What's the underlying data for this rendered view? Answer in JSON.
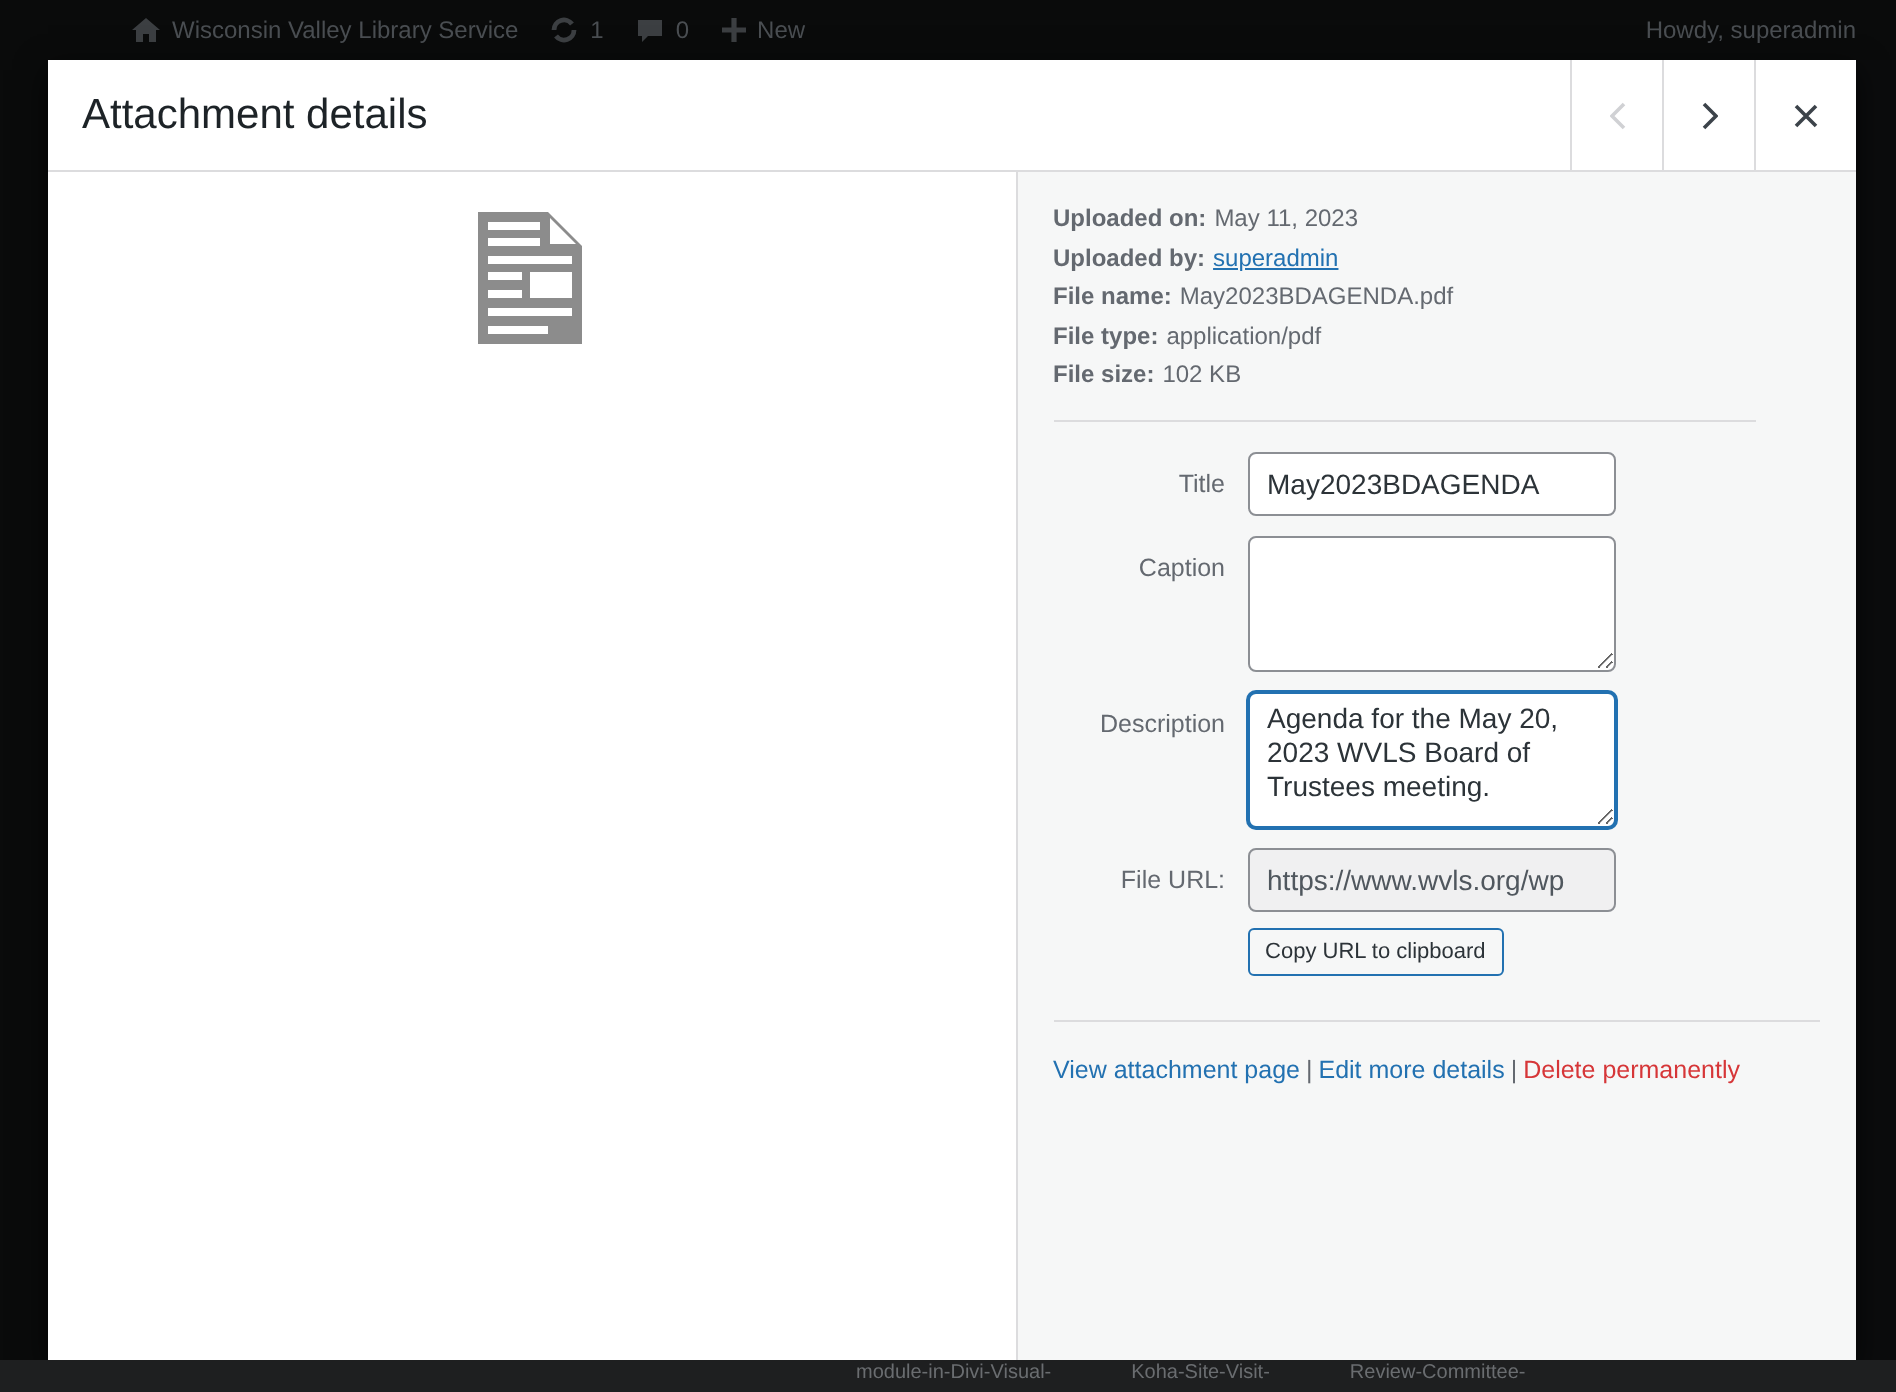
{
  "admin_bar": {
    "site": "Wisconsin Valley Library Service",
    "updates": "1",
    "comments": "0",
    "new": "New",
    "greeting": "Howdy, superadmin"
  },
  "modal": {
    "title": "Attachment details",
    "nav": [
      {
        "kind": "prev",
        "disabled": true
      },
      {
        "kind": "next",
        "disabled": false
      },
      {
        "kind": "close",
        "disabled": false
      }
    ],
    "meta": [
      {
        "kind": "text",
        "label": "Uploaded on:",
        "value": "May 11, 2023"
      },
      {
        "kind": "link",
        "label": "Uploaded by:",
        "value": "superadmin"
      },
      {
        "kind": "text",
        "label": "File name:",
        "value": "May2023BDAGENDA.pdf"
      },
      {
        "kind": "text",
        "label": "File type:",
        "value": "application/pdf"
      },
      {
        "kind": "text",
        "label": "File size:",
        "value": "102 KB"
      }
    ],
    "fields": [
      {
        "kind": "input",
        "label": "Title",
        "value": "May2023BDAGENDA",
        "focused": false,
        "readonly": false
      },
      {
        "kind": "textarea",
        "label": "Caption",
        "focused": false,
        "readonly": false
      },
      {
        "kind": "textarea",
        "label": "Description",
        "value": "Agenda for the May 20, 2023 WVLS Board of Trustees meeting.",
        "focused": true,
        "readonly": false
      },
      {
        "kind": "input",
        "label": "File URL:",
        "value": "https://www.wvls.org/wp",
        "focused": false,
        "readonly": true
      }
    ],
    "copy_button": "Copy URL to clipboard",
    "actions": [
      {
        "kind": "link",
        "text": "View attachment page",
        "separator": "|"
      },
      {
        "kind": "link",
        "text": "Edit more details",
        "separator": "|"
      },
      {
        "kind": "delete",
        "text": "Delete permanently"
      }
    ]
  },
  "background_items": [
    "module-in-Divi-Visual-",
    "Koha-Site-Visit-",
    "Review-Committee-"
  ]
}
